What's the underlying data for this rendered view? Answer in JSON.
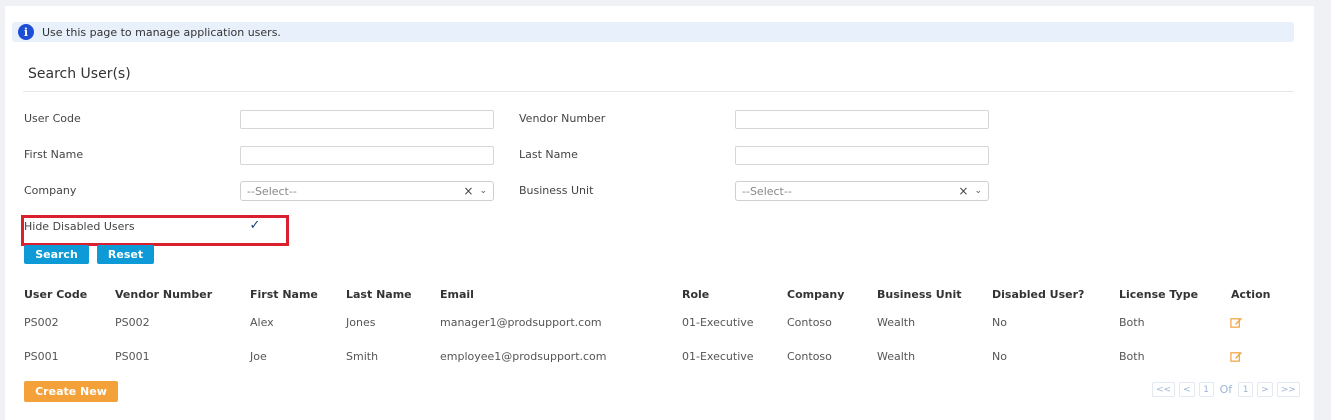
{
  "info": {
    "message": "Use this page to manage application users."
  },
  "search": {
    "title": "Search User(s)",
    "user_code_label": "User Code",
    "vendor_number_label": "Vendor Number",
    "first_name_label": "First Name",
    "last_name_label": "Last Name",
    "company_label": "Company",
    "company_value": "--Select--",
    "business_unit_label": "Business Unit",
    "business_unit_value": "--Select--",
    "hide_disabled_label": "Hide Disabled Users",
    "hide_disabled_checked": true,
    "search_button": "Search",
    "reset_button": "Reset"
  },
  "table": {
    "headers": {
      "user_code": "User Code",
      "vendor_number": "Vendor Number",
      "first_name": "First Name",
      "last_name": "Last Name",
      "email": "Email",
      "role": "Role",
      "company": "Company",
      "business_unit": "Business Unit",
      "disabled": "Disabled User?",
      "license_type": "License Type",
      "action": "Action"
    },
    "rows": [
      {
        "user_code": "PS002",
        "vendor_number": "PS002",
        "first_name": "Alex",
        "last_name": "Jones",
        "email": "manager1@prodsupport.com",
        "role": "01-Executive",
        "company": "Contoso",
        "business_unit": "Wealth",
        "disabled": "No",
        "license_type": "Both"
      },
      {
        "user_code": "PS001",
        "vendor_number": "PS001",
        "first_name": "Joe",
        "last_name": "Smith",
        "email": "employee1@prodsupport.com",
        "role": "01-Executive",
        "company": "Contoso",
        "business_unit": "Wealth",
        "disabled": "No",
        "license_type": "Both"
      }
    ]
  },
  "create_button": "Create New",
  "pager": {
    "first": "<<",
    "prev": "<",
    "page": "1",
    "of": "Of",
    "total": "1",
    "next": ">",
    "last": ">>"
  },
  "colors": {
    "primary": "#0e9ad6",
    "accent": "#f4a13a",
    "highlight": "#d9202e"
  },
  "icons": {
    "info": "info-icon",
    "edit": "edit-icon",
    "clear": "clear-icon",
    "dropdown": "chevron-down-icon",
    "check": "checkmark-icon"
  }
}
